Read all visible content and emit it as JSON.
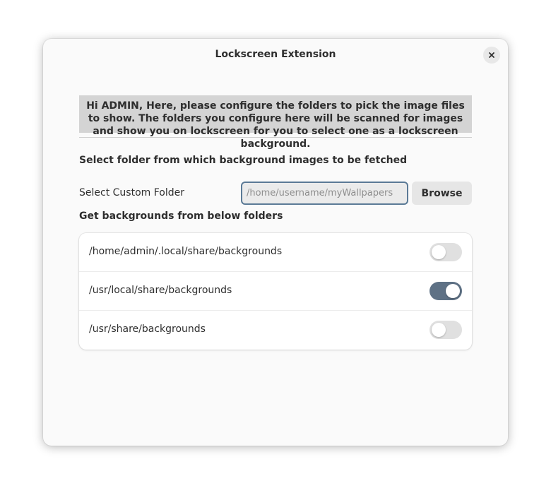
{
  "window": {
    "title": "Lockscreen Extension",
    "close_icon": "close-icon"
  },
  "banner": {
    "text": "Hi ADMIN, Here, please configure the folders to pick the image files to show. The folders you configure here will be scanned for images and show you on lockscreen for you to select one as a lockscreen background."
  },
  "section1": {
    "heading": "Select folder from which background images to be fetched",
    "custom_folder_label": "Select Custom Folder",
    "path_placeholder": "/home/username/myWallpapers",
    "path_value": "",
    "browse_label": "Browse"
  },
  "section2": {
    "heading": "Get backgrounds from below folders",
    "folders": [
      {
        "path": "/home/admin/.local/share/backgrounds",
        "enabled": false
      },
      {
        "path": "/usr/local/share/backgrounds",
        "enabled": true
      },
      {
        "path": "/usr/share/backgrounds",
        "enabled": false
      }
    ]
  },
  "colors": {
    "switch_on": "#5e7185",
    "switch_off": "#e0e0e0",
    "input_border": "#5b7a96",
    "banner_bg": "#d4d4d4"
  }
}
